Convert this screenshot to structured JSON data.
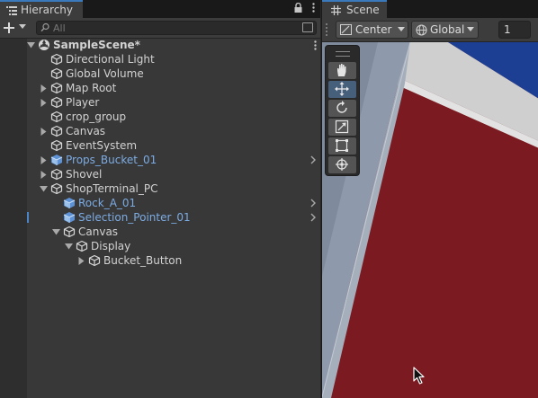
{
  "hierarchy": {
    "tab_label": "Hierarchy",
    "tab_icon": "hierarchy-list-icon",
    "header_icons": [
      "lock-icon",
      "more-vertical-icon"
    ],
    "add_button_icon": "plus-icon",
    "search_placeholder": "All",
    "items": [
      {
        "label": "SampleScene*",
        "depth": 0,
        "icon": "unity-scene-icon",
        "expanded": true,
        "bold": true,
        "has_more_menu": true
      },
      {
        "label": "Directional Light",
        "depth": 1,
        "icon": "gameobject-cube-icon"
      },
      {
        "label": "Global Volume",
        "depth": 1,
        "icon": "gameobject-cube-icon"
      },
      {
        "label": "Map Root",
        "depth": 1,
        "icon": "gameobject-cube-icon",
        "collapsed": true
      },
      {
        "label": "Player",
        "depth": 1,
        "icon": "gameobject-cube-icon",
        "collapsed": true
      },
      {
        "label": "crop_group",
        "depth": 1,
        "icon": "gameobject-cube-icon"
      },
      {
        "label": "Canvas",
        "depth": 1,
        "icon": "gameobject-cube-icon",
        "collapsed": true
      },
      {
        "label": "EventSystem",
        "depth": 1,
        "icon": "gameobject-cube-icon"
      },
      {
        "label": "Props_Bucket_01",
        "depth": 1,
        "icon": "prefab-cube-icon",
        "collapsed": true,
        "prefab": true,
        "chevron": true
      },
      {
        "label": "Shovel",
        "depth": 1,
        "icon": "gameobject-cube-icon",
        "collapsed": true
      },
      {
        "label": "ShopTerminal_PC",
        "depth": 1,
        "icon": "gameobject-cube-icon",
        "expanded": true
      },
      {
        "label": "Rock_A_01",
        "depth": 2,
        "icon": "prefab-cube-icon",
        "prefab": true,
        "chevron": true
      },
      {
        "label": "Selection_Pointer_01",
        "depth": 2,
        "icon": "prefab-cube-icon",
        "prefab": true,
        "chevron": true,
        "modified": true
      },
      {
        "label": "Canvas",
        "depth": 2,
        "icon": "gameobject-cube-icon",
        "expanded": true
      },
      {
        "label": "Display",
        "depth": 3,
        "icon": "gameobject-cube-icon",
        "expanded": true
      },
      {
        "label": "Bucket_Button",
        "depth": 4,
        "icon": "gameobject-cube-icon",
        "collapsed": true
      }
    ]
  },
  "scene": {
    "tab_label": "Scene",
    "tab_icon": "grid-hash-icon",
    "pivot_mode": "Center",
    "pivot_icon": "pivot-center-icon",
    "pivot_rotation": "Global",
    "pivot_rotation_icon": "globe-icon",
    "grid_snap_value": "1",
    "tools": [
      {
        "name": "hand-tool-icon",
        "active": false
      },
      {
        "name": "move-tool-icon",
        "active": true
      },
      {
        "name": "rotate-tool-icon",
        "active": false
      },
      {
        "name": "scale-tool-icon",
        "active": false
      },
      {
        "name": "rect-tool-icon",
        "active": false
      },
      {
        "name": "transform-tool-icon",
        "active": false
      }
    ]
  },
  "colors": {
    "prefab_text": "#7cabe3",
    "selection_accent": "#4b85c8",
    "viewport_red": "#7a1a1f",
    "viewport_blue": "#1c3f94"
  }
}
